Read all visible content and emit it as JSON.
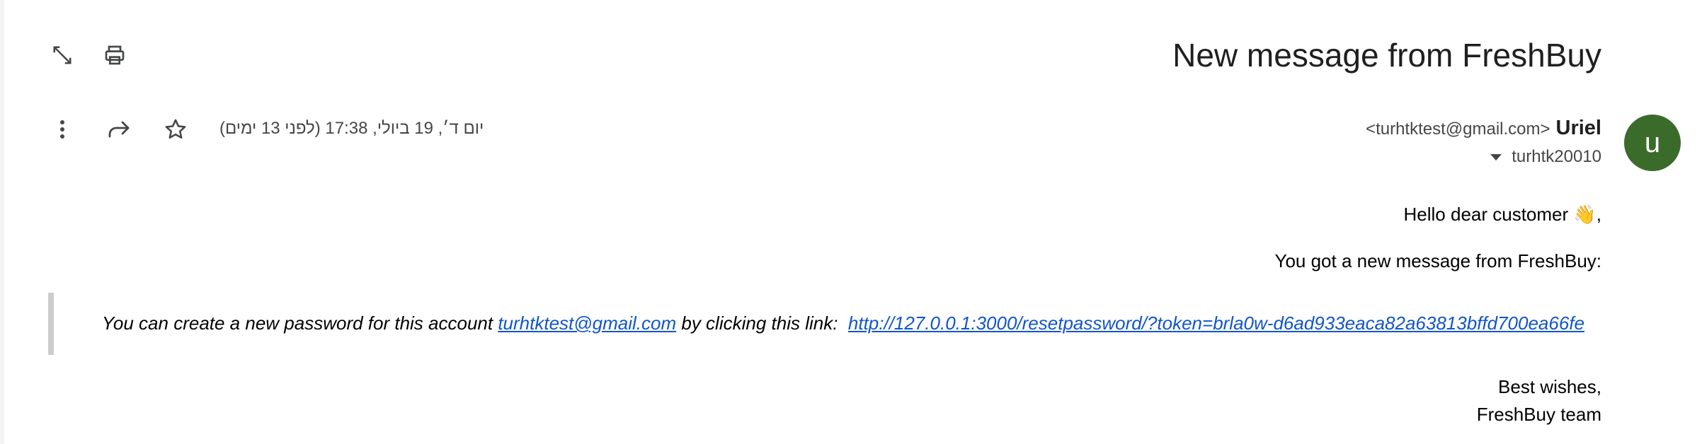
{
  "subject": "New message from FreshBuy",
  "toolbar": {
    "expand_icon": "open-in-new-window-icon",
    "print_icon": "print-icon"
  },
  "message": {
    "date": "יום ד׳, 19 ביולי, 17:38 (לפני 13 ימים)",
    "sender_name": "Uriel",
    "sender_email": "<turhtktest@gmail.com>",
    "recipient": "turhtk20010",
    "avatar_letter": "u",
    "avatar_color": "#3b6b2a",
    "actions": {
      "more_icon": "more-vert-icon",
      "forward_icon": "forward-icon",
      "star_icon": "star-icon"
    }
  },
  "body": {
    "greeting": "Hello dear customer 👋,",
    "intro": "You got a new message from FreshBuy:",
    "quote_part1": "You can create a new password for this account ",
    "quote_email": "turhtktest@gmail.com",
    "quote_part2": " by clicking this link:  ",
    "quote_link": "http://127.0.0.1:3000/resetpassword/?token=brla0w-d6ad933eaca82a63813bffd700ea66fe",
    "closing": "Best wishes,",
    "signature": "FreshBuy team"
  },
  "colors": {
    "link": "#1155cc",
    "quote_border": "#cccccc"
  }
}
